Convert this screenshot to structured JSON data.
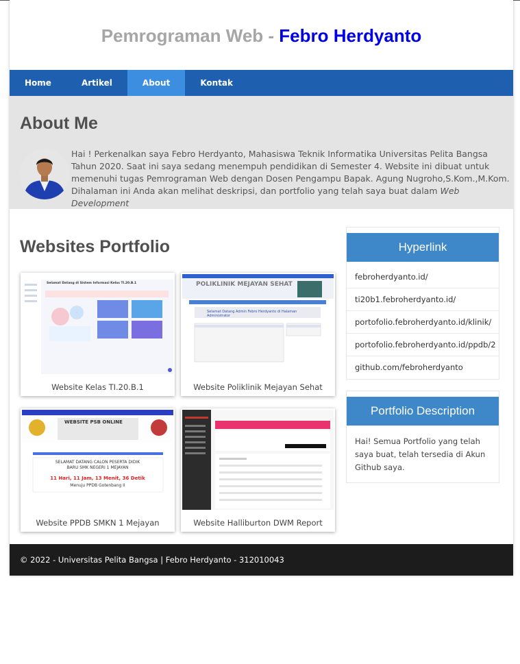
{
  "header": {
    "title_prefix": "Pemrograman Web - ",
    "title_name": "Febro Herdyanto"
  },
  "nav": {
    "items": [
      "Home",
      "Artikel",
      "About",
      "Kontak"
    ],
    "active": "About"
  },
  "about": {
    "heading": "About Me",
    "text": "Hai ! Perkenalkan saya Febro Herdyanto, Mahasiswa Teknik Informatika Universitas Pelita Bangsa Tahun 2020. Saat ini saya sedang menempuh pendidikan di Semester 4. Website ini dibuat untuk memenuhi tugas Pemrograman Web dengan Dosen Pengampu Bapak. Agung Nugroho,S.Kom.,M.Kom. Dihalaman ini Anda akan melihat deskripsi, dan portfolio yang telah saya buat dalam ",
    "text_em": "Web Development"
  },
  "portfolio": {
    "heading": "Websites Portfolio",
    "items": [
      {
        "caption": "Website Kelas TI.20.B.1"
      },
      {
        "caption": "Website Poliklinik Mejayan Sehat"
      },
      {
        "caption": "Website PPDB SMKN 1 Mejayan"
      },
      {
        "caption": "Website Halliburton DWM Report"
      }
    ]
  },
  "screens": {
    "kelas_title": "Selamat Datang di Sistem Informasi Kelas TI.20.B.1",
    "poli_title": "POLIKLINIK MEJAYAN SEHAT",
    "poli_welcome": "Selamat Datang Admin Febro Herdyanto di Halaman Administrator",
    "ppdb_title": "WEBSITE PSB ONLINE",
    "ppdb_line1": "SELAMAT DATANG CALON PESERTA DIDIK",
    "ppdb_line2": "BARU SMK NEGERI 1 MEJAYAN",
    "ppdb_countdown": "11 Hari, 11 Jam, 13 Menit, 36 Detik",
    "ppdb_sub": "Menuju PPDB Gotenbang II"
  },
  "sidebar": {
    "hyperlink_title": "Hyperlink",
    "links": [
      "febroherdyanto.id/",
      "ti20b1.febroherdyanto.id/",
      "portofolio.febroherdyanto.id/klinik/",
      "portofolio.febroherdyanto.id/ppdb/2",
      "github.com/febroherdyanto"
    ],
    "desc_title": "Portfolio Description",
    "desc_text": "Hai! Semua Portfolio yang telah saya buat, telah tersedia di Akun Github saya."
  },
  "footer": {
    "text": "© 2022 - Universitas Pelita Bangsa | Febro Herdyanto - 312010043"
  },
  "colors": {
    "nav": "#1f5fb0",
    "nav_active": "#3c8ee0",
    "accent_name": "#0000e6",
    "side_head": "#3e87c9",
    "footer": "#1c1c1c"
  }
}
